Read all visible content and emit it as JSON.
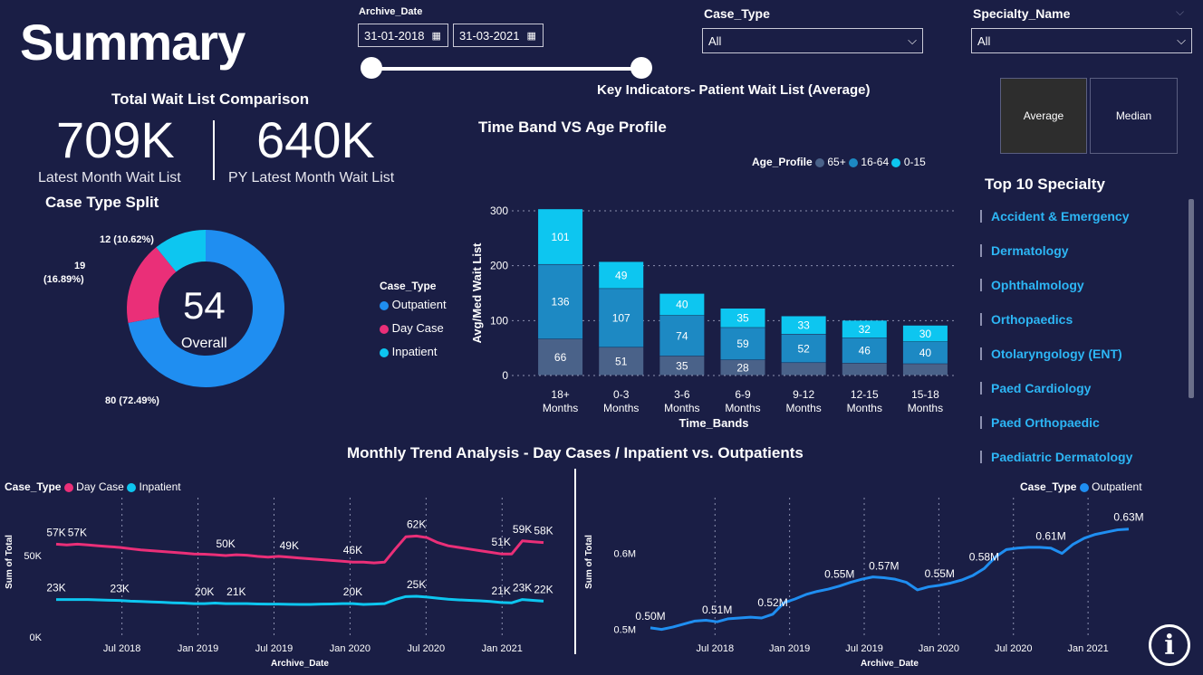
{
  "page": {
    "title": "Summary"
  },
  "filters": {
    "archive_date": {
      "label": "Archive_Date",
      "start": "31-01-2018",
      "end": "31-03-2021"
    },
    "case_type": {
      "label": "Case_Type",
      "value": "All"
    },
    "specialty_name": {
      "label": "Specialty_Name",
      "value": "All"
    }
  },
  "key_indicators": {
    "title": "Key Indicators- Patient Wait List (Average)"
  },
  "toggle": {
    "average": "Average",
    "median": "Median"
  },
  "wait_list": {
    "title": "Total Wait List Comparison",
    "latest_value": "709K",
    "latest_label": "Latest Month Wait List",
    "py_value": "640K",
    "py_label": "PY Latest Month Wait List"
  },
  "case_split": {
    "title": "Case Type Split",
    "center_value": "54",
    "center_label": "Overall",
    "legend_title": "Case_Type",
    "slices": [
      {
        "name": "Outpatient",
        "value": 80,
        "label": "80 (72.49%)",
        "color": "#1f8ef1"
      },
      {
        "name": "Day Case",
        "value": 19,
        "label": "19\n(16.89%)",
        "color": "#ea2f78"
      },
      {
        "name": "Inpatient",
        "value": 12,
        "label": "12 (10.62%)",
        "color": "#0dc6f0"
      }
    ]
  },
  "top_specialty": {
    "title": "Top 10 Specialty",
    "items": [
      "Accident & Emergency",
      "Dermatology",
      "Ophthalmology",
      "Orthopaedics",
      "Otolaryngology (ENT)",
      "Paed Cardiology",
      "Paed Orthopaedic",
      "Paediatric Dermatology"
    ]
  },
  "chart_data": [
    {
      "type": "bar",
      "title": "Time Band VS Age Profile",
      "legend_title": "Age_Profile",
      "xlabel": "Time_Bands",
      "ylabel": "Avg/Med Wait List",
      "ylim": [
        0,
        300
      ],
      "yticks": [
        0,
        100,
        200,
        300
      ],
      "categories": [
        "18+\nMonths",
        "0-3\nMonths",
        "3-6\nMonths",
        "6-9\nMonths",
        "9-12\nMonths",
        "12-15\nMonths",
        "15-18\nMonths"
      ],
      "series": [
        {
          "name": "65+",
          "color": "#4a6289",
          "values": [
            66,
            51,
            35,
            28,
            23,
            22,
            21
          ],
          "labels": [
            "66",
            "51",
            "35",
            "28",
            "",
            "",
            ""
          ]
        },
        {
          "name": "16-64",
          "color": "#1d89c3",
          "values": [
            136,
            107,
            74,
            59,
            52,
            46,
            40
          ],
          "labels": [
            "136",
            "107",
            "74",
            "59",
            "52",
            "46",
            "40"
          ]
        },
        {
          "name": "0-15",
          "color": "#0dc6f0",
          "values": [
            101,
            49,
            40,
            35,
            33,
            32,
            30
          ],
          "labels": [
            "101",
            "49",
            "40",
            "35",
            "33",
            "32",
            "30"
          ]
        }
      ]
    },
    {
      "type": "line",
      "title": "Monthly Trend Analysis - Day Cases / Inpatient vs. Outpatients",
      "legend_title": "Case_Type",
      "xlabel": "Archive_Date",
      "ylabel": "Sum of Total",
      "ylim": [
        0,
        70000
      ],
      "yticks": [
        {
          "v": 0,
          "t": "0K"
        },
        {
          "v": 50000,
          "t": "50K"
        }
      ],
      "xticks": [
        "Jul 2018",
        "Jan 2019",
        "Jul 2019",
        "Jan 2020",
        "Jul 2020",
        "Jan 2021"
      ],
      "series": [
        {
          "name": "Day Case",
          "color": "#ea2f78",
          "values": [
            57000,
            56500,
            57000,
            56500,
            56000,
            55500,
            55000,
            54200,
            53500,
            53000,
            52500,
            52000,
            51500,
            51000,
            50800,
            50500,
            50000,
            50500,
            50200,
            49500,
            49000,
            49500,
            49000,
            48500,
            48000,
            47500,
            47000,
            46500,
            46000,
            46000,
            45500,
            46000,
            54000,
            61500,
            62000,
            61000,
            58000,
            56000,
            55000,
            54000,
            53000,
            52000,
            51000,
            51000,
            59000,
            58500,
            58000
          ],
          "labels": [
            {
              "i": 0,
              "t": "57K"
            },
            {
              "i": 2,
              "t": "57K"
            },
            {
              "i": 16,
              "t": "50K"
            },
            {
              "i": 22,
              "t": "49K"
            },
            {
              "i": 28,
              "t": "46K"
            },
            {
              "i": 34,
              "t": "62K"
            },
            {
              "i": 42,
              "t": "51K"
            },
            {
              "i": 44,
              "t": "59K"
            },
            {
              "i": 46,
              "t": "58K"
            }
          ]
        },
        {
          "name": "Inpatient",
          "color": "#0dc6f0",
          "values": [
            23000,
            23000,
            23000,
            23000,
            22800,
            22600,
            22400,
            22000,
            21800,
            21500,
            21300,
            21000,
            20800,
            20500,
            20500,
            20800,
            20500,
            20500,
            20500,
            20300,
            20200,
            20200,
            20100,
            20000,
            20000,
            20200,
            20300,
            20500,
            20500,
            20000,
            20200,
            20500,
            23000,
            24800,
            25000,
            24500,
            23800,
            23200,
            22800,
            22500,
            22200,
            21800,
            21200,
            21000,
            23000,
            22500,
            22000
          ],
          "labels": [
            {
              "i": 0,
              "t": "23K"
            },
            {
              "i": 6,
              "t": "23K"
            },
            {
              "i": 14,
              "t": "20K"
            },
            {
              "i": 17,
              "t": "21K"
            },
            {
              "i": 28,
              "t": "20K"
            },
            {
              "i": 34,
              "t": "25K"
            },
            {
              "i": 42,
              "t": "21K"
            },
            {
              "i": 44,
              "t": "23K"
            },
            {
              "i": 46,
              "t": "22K"
            }
          ]
        }
      ]
    },
    {
      "type": "line",
      "legend_title": "Case_Type",
      "xlabel": "Archive_Date",
      "ylabel": "Sum of Total",
      "ylim": [
        490000,
        640000
      ],
      "yticks": [
        {
          "v": 500000,
          "t": "0.5M"
        },
        {
          "v": 600000,
          "t": "0.6M"
        }
      ],
      "xticks": [
        "Jul 2018",
        "Jan 2019",
        "Jul 2019",
        "Jan 2020",
        "Jul 2020",
        "Jan 2021"
      ],
      "series": [
        {
          "name": "Outpatient",
          "color": "#1f8ef1",
          "values": [
            502000,
            500000,
            503000,
            507000,
            511000,
            512000,
            510000,
            514000,
            515000,
            516000,
            515000,
            520000,
            535000,
            540000,
            546000,
            550000,
            553000,
            557000,
            562000,
            566000,
            569000,
            568000,
            566000,
            562000,
            552000,
            556000,
            558000,
            561000,
            565000,
            571000,
            580000,
            595000,
            605000,
            607000,
            608000,
            608000,
            607000,
            600000,
            612000,
            620000,
            625000,
            628000,
            631000,
            632000
          ],
          "labels": [
            {
              "i": 0,
              "t": "0.50M"
            },
            {
              "i": 6,
              "t": "0.51M"
            },
            {
              "i": 11,
              "t": "0.52M"
            },
            {
              "i": 17,
              "t": "0.55M"
            },
            {
              "i": 21,
              "t": "0.57M"
            },
            {
              "i": 26,
              "t": "0.55M"
            },
            {
              "i": 30,
              "t": "0.58M"
            },
            {
              "i": 36,
              "t": "0.61M"
            },
            {
              "i": 43,
              "t": "0.63M"
            }
          ]
        }
      ]
    }
  ]
}
